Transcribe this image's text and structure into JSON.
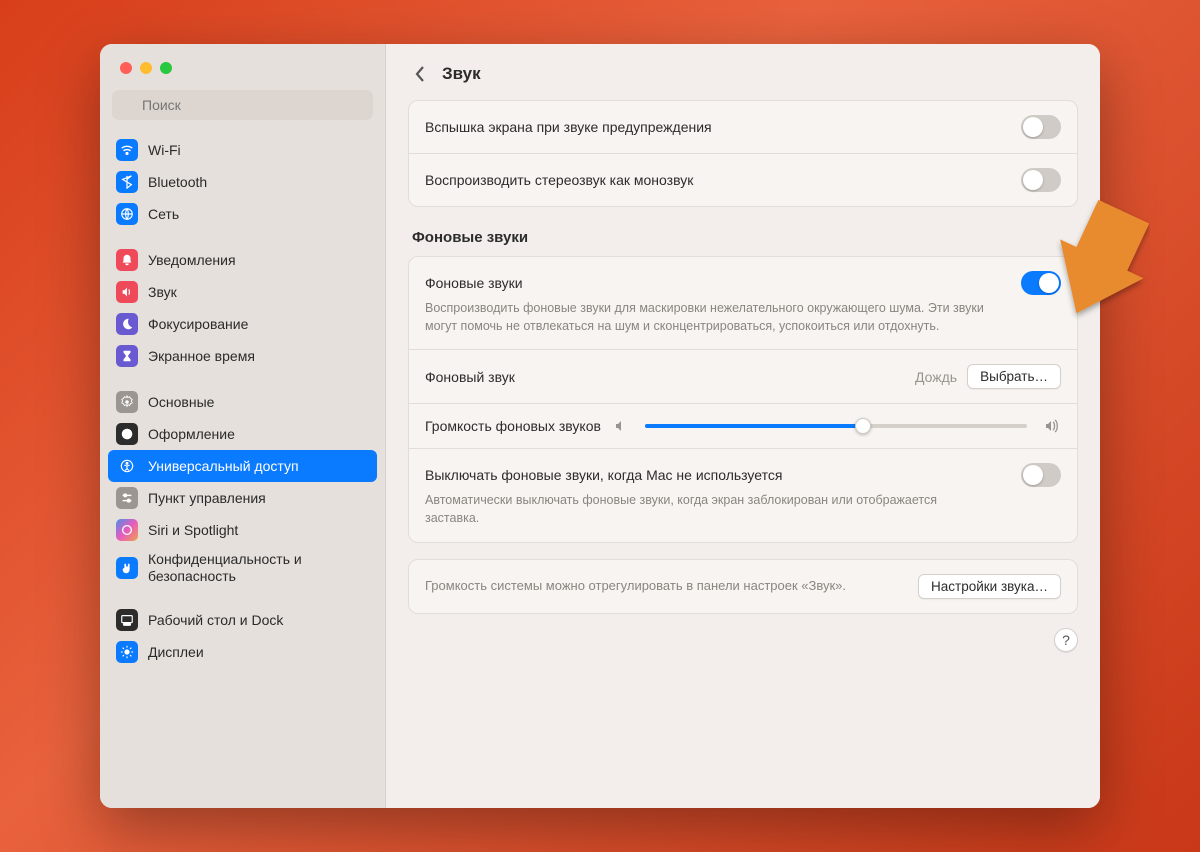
{
  "search": {
    "placeholder": "Поиск"
  },
  "sidebar": {
    "items": [
      {
        "label": "Wi-Fi",
        "bg": "#0a7aff"
      },
      {
        "label": "Bluetooth",
        "bg": "#0a7aff"
      },
      {
        "label": "Сеть",
        "bg": "#0a7aff"
      },
      {
        "label": "Уведомления",
        "bg": "#ee4a5a"
      },
      {
        "label": "Звук",
        "bg": "#ee4a5a"
      },
      {
        "label": "Фокусирование",
        "bg": "#6a5ad1"
      },
      {
        "label": "Экранное время",
        "bg": "#6a5ad1"
      },
      {
        "label": "Основные",
        "bg": "#9b9691"
      },
      {
        "label": "Оформление",
        "bg": "#2c2c2c"
      },
      {
        "label": "Универсальный доступ",
        "bg": "#0a7aff"
      },
      {
        "label": "Пункт управления",
        "bg": "#9b9691"
      },
      {
        "label": "Siri и Spotlight",
        "bg": "#2c2c2c"
      },
      {
        "label": "Конфиденциальность и безопасность",
        "bg": "#0a7aff"
      },
      {
        "label": "Рабочий стол и Dock",
        "bg": "#2c2c2c"
      },
      {
        "label": "Дисплеи",
        "bg": "#0a7aff"
      }
    ]
  },
  "header": {
    "title": "Звук"
  },
  "rows": {
    "flash": "Вспышка экрана при звуке предупреждения",
    "mono": "Воспроизводить стереозвук как монозвук"
  },
  "section": {
    "title": "Фоновые звуки"
  },
  "bg_sounds": {
    "title": "Фоновые звуки",
    "desc": "Воспроизводить фоновые звуки для маскировки нежелательного окружающего шума. Эти звуки могут помочь не отвлекаться на шум и сконцентрироваться, успокоиться или отдохнуть.",
    "sound_label": "Фоновый звук",
    "sound_value": "Дождь",
    "choose_btn": "Выбрать…",
    "volume_label": "Громкость фоновых звуков",
    "volume_pct": 57,
    "off_when_idle_title": "Выключать фоновые звуки, когда Mac не используется",
    "off_when_idle_desc": "Автоматически выключать фоновые звуки, когда экран заблокирован или отображается заставка."
  },
  "footer": {
    "text": "Громкость системы можно отрегулировать в панели настроек «Звук».",
    "btn": "Настройки звука…"
  },
  "help": "?"
}
